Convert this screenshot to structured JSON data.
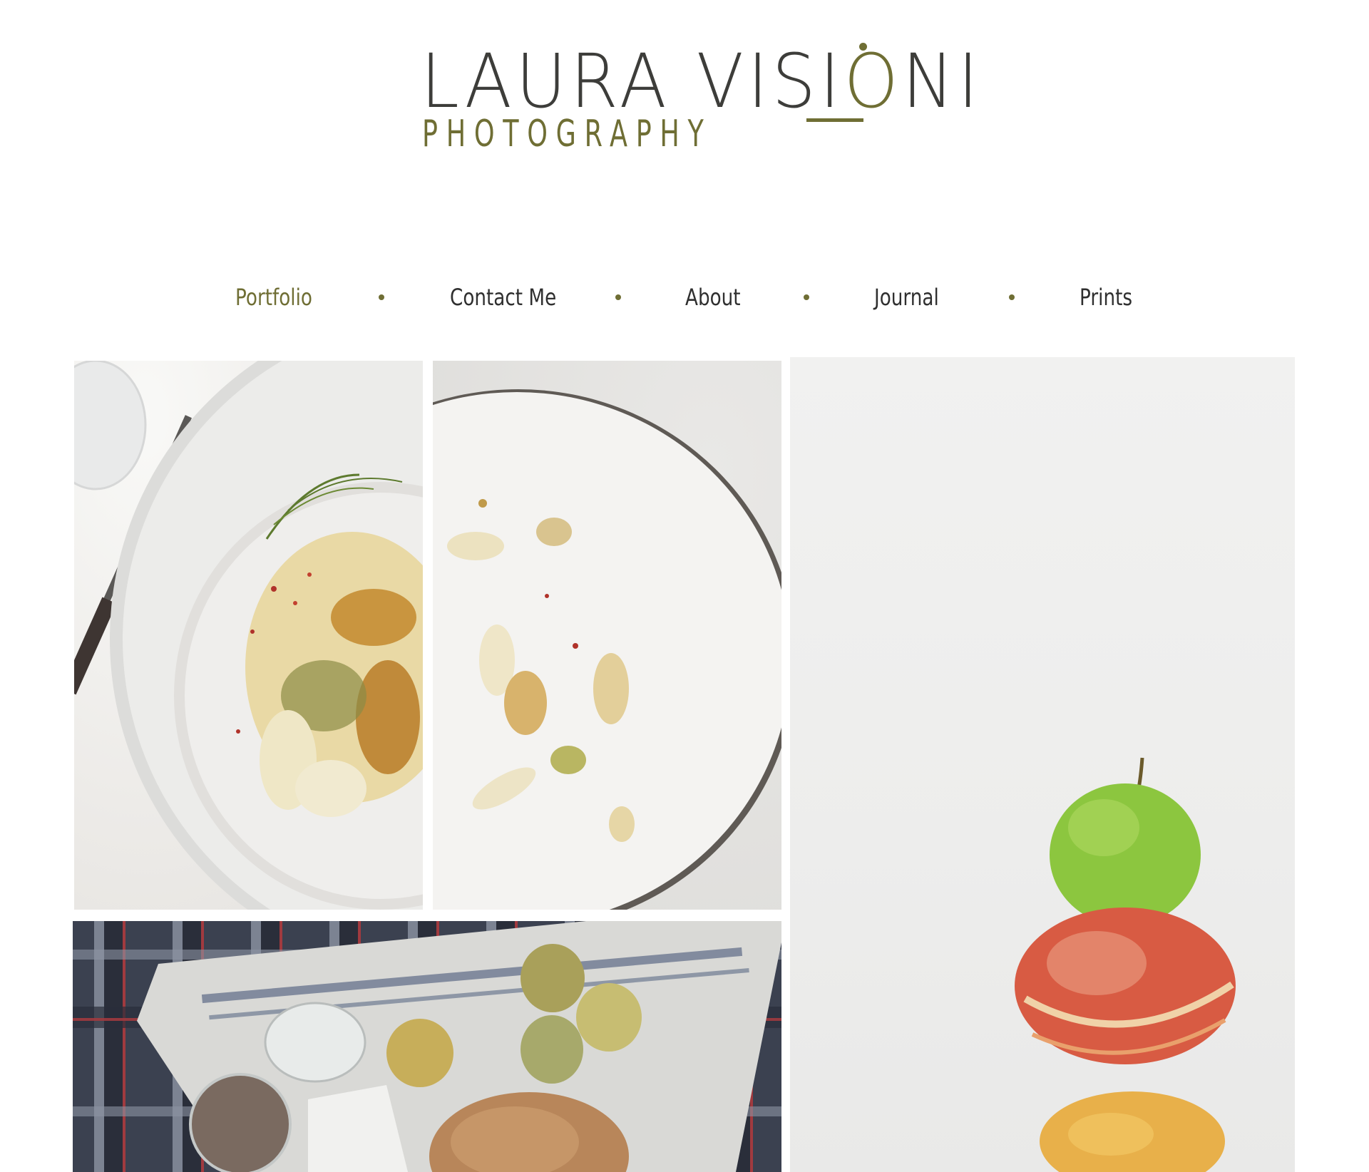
{
  "brand": {
    "name_part1": "LAURA VISI",
    "name_o": "O",
    "name_part2": "NI",
    "tagline": "PHOTOGRAPHY",
    "accent_color": "#6f6e34",
    "text_color": "#3d3d3a"
  },
  "nav": {
    "items": [
      {
        "label": "Portfolio",
        "active": true
      },
      {
        "label": "Contact Me",
        "active": false
      },
      {
        "label": "About",
        "active": false
      },
      {
        "label": "Journal",
        "active": false
      },
      {
        "label": "Prints",
        "active": false
      }
    ]
  },
  "gallery": {
    "tiles": [
      {
        "subject": "roasted fennel on white plate, left half"
      },
      {
        "subject": "roasted fennel remnants on white plate, right half"
      },
      {
        "subject": "stacked green and red apples"
      },
      {
        "subject": "picnic with pears, bread and jar on plaid blanket"
      }
    ]
  }
}
